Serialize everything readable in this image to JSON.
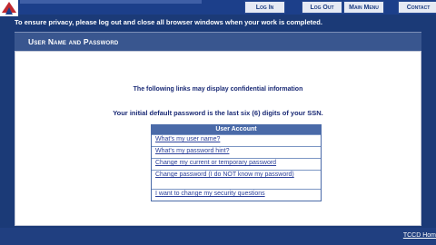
{
  "nav": {
    "items": [
      {
        "label": "Log In"
      },
      {
        "label": "Log Out"
      },
      {
        "label": "Main Menu"
      },
      {
        "label": "Contact"
      }
    ]
  },
  "privacy_notice": "To ensure privacy, please log out and close all browser windows when your work is completed.",
  "section": {
    "title": "User Name and Password"
  },
  "main": {
    "confidential_notice": "The following links may display confidential information",
    "password_notice": "Your initial default password is the last six (6) digits of your SSN."
  },
  "user_account": {
    "header": "User Account",
    "links": [
      {
        "label": "What's my user name?"
      },
      {
        "label": "What's my password hint?"
      },
      {
        "label": "Change my current or temporary password"
      },
      {
        "label": "Change password (I do NOT know my password)"
      },
      {
        "label": "I want to change my security questions"
      }
    ]
  },
  "footer": {
    "link": "TCCD Hom"
  },
  "colors": {
    "background": "#1b3a77",
    "link": "#2a3f9a",
    "table_border": "#4a6aa8"
  },
  "icons": {
    "logo": "tccd-logo-icon"
  }
}
